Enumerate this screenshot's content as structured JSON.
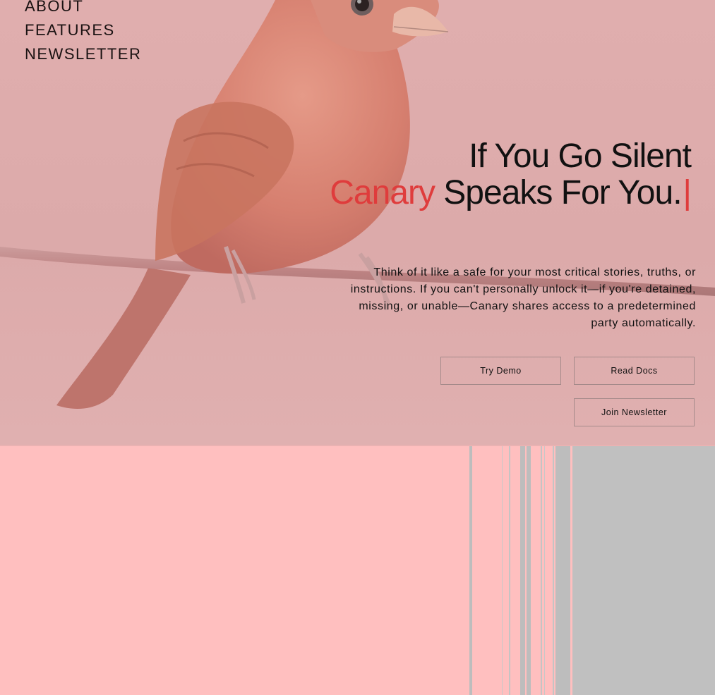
{
  "nav": {
    "items": [
      "ABOUT",
      "FEATURES",
      "NEWSLETTER"
    ]
  },
  "hero": {
    "title_line1": "If You Go Silent",
    "title_accent": "Canary",
    "title_rest": " Speaks For You.",
    "cursor": "|",
    "description": "Think of it like a safe for your most critical stories, truths, or instructions. If you can't personally unlock it—if you're detained, missing, or unable—Canary shares access to a predetermined party automatically.",
    "buttons": {
      "try_demo": "Try Demo",
      "read_docs": "Read Docs",
      "join_newsletter": "Join Newsletter"
    }
  },
  "colors": {
    "accent": "#df3c3c",
    "hero_bg": "#ddabab",
    "page_bg": "#ffbfbf",
    "gray_panel": "#c0c0c0"
  },
  "icons": {
    "bird": "canary-bird-illustration"
  }
}
